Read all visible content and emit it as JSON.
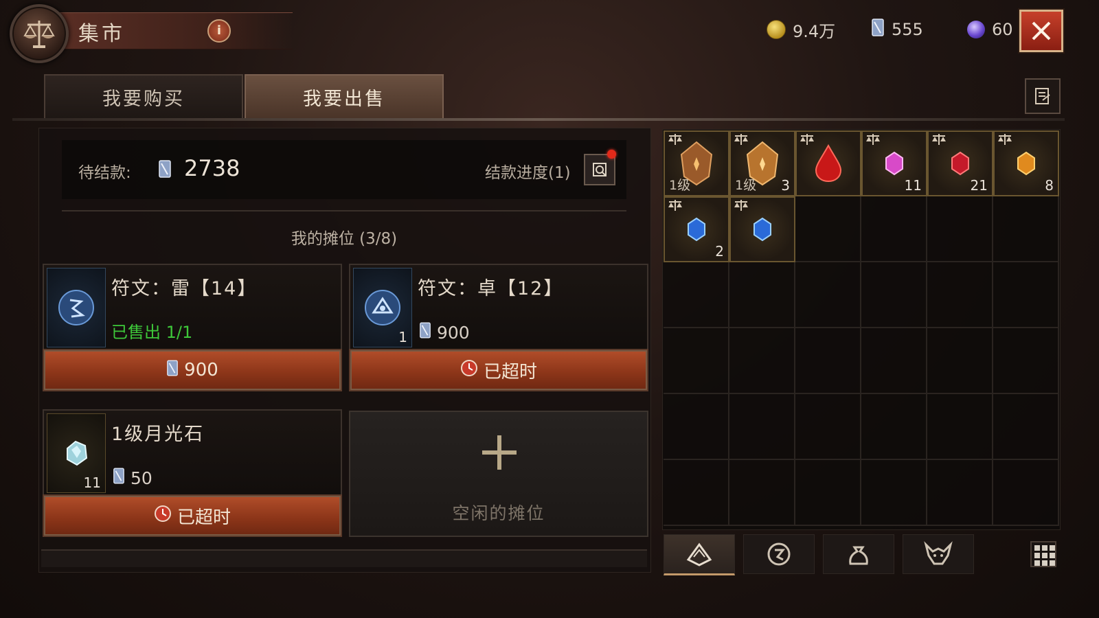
{
  "header": {
    "title": "集市",
    "info_label": "i",
    "currencies": [
      {
        "name": "gold",
        "icon": "gold-coin-icon",
        "value": "9.4万",
        "color": "#d6b54a"
      },
      {
        "name": "platinum",
        "icon": "platinum-crystal-icon",
        "value": "555",
        "color": "#a9b8d8"
      },
      {
        "name": "eternal-orb",
        "icon": "purple-orb-icon",
        "value": "60",
        "color": "#8a6ae0"
      }
    ],
    "close_icon": "close-icon"
  },
  "tabs": [
    {
      "label": "我要购买",
      "active": false
    },
    {
      "label": "我要出售",
      "active": true
    }
  ],
  "pending": {
    "label": "待结款:",
    "amount": "2738",
    "progress_label": "结款进度(1)"
  },
  "stalls_title": "我的摊位 (3/8)",
  "stalls": [
    {
      "name": "符文：雷【14】",
      "status": "已售出 1/1",
      "count": "",
      "price": "",
      "button_label": "900",
      "button_icon": "platinum-crystal-icon"
    },
    {
      "name": "符文：卓【12】",
      "status": "",
      "count": "1",
      "price": "900",
      "button_label": "已超时",
      "button_icon": "timeout-clock-icon"
    },
    {
      "name": "1级月光石",
      "status": "",
      "count": "11",
      "price": "50",
      "button_label": "已超时",
      "button_icon": "timeout-clock-icon"
    }
  ],
  "empty_stall_label": "空闲的摊位",
  "inventory": [
    {
      "item": "amber-gem",
      "level": "1级",
      "count": ""
    },
    {
      "item": "amber-gem",
      "level": "1级",
      "count": "3"
    },
    {
      "item": "blood-drop",
      "level": "",
      "count": ""
    },
    {
      "item": "pink-gem",
      "level": "",
      "count": "11"
    },
    {
      "item": "ruby-gem",
      "level": "",
      "count": "21"
    },
    {
      "item": "topaz-gem",
      "level": "",
      "count": "8"
    },
    {
      "item": "sapphire-gem",
      "level": "",
      "count": "2"
    },
    {
      "item": "sapphire-gem",
      "level": "",
      "count": ""
    }
  ],
  "bottom_tabs": [
    {
      "icon": "gem-category-icon",
      "active": true
    },
    {
      "icon": "rune-category-icon",
      "active": false
    },
    {
      "icon": "bag-category-icon",
      "active": false
    },
    {
      "icon": "demon-category-icon",
      "active": false
    }
  ]
}
